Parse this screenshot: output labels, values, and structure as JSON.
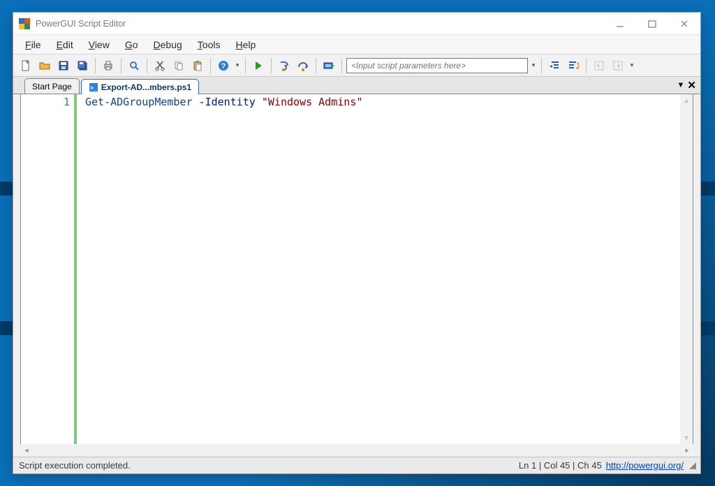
{
  "window": {
    "title": "PowerGUI Script Editor"
  },
  "menu": {
    "file": "File",
    "edit": "Edit",
    "view": "View",
    "go": "Go",
    "debug": "Debug",
    "tools": "Tools",
    "help": "Help"
  },
  "toolbar": {
    "param_placeholder": "<Input script parameters here>"
  },
  "tabs": {
    "start": "Start Page",
    "active": "Export-AD...mbers.ps1"
  },
  "editor": {
    "line_numbers": [
      "1"
    ],
    "code": {
      "cmdlet": "Get-ADGroupMember",
      "param": " -Identity ",
      "string": "\"Windows Admins\""
    }
  },
  "status": {
    "msg": "Script execution completed.",
    "pos": "Ln 1 | Col 45 | Ch 45",
    "link": "http://powergui.org/"
  }
}
